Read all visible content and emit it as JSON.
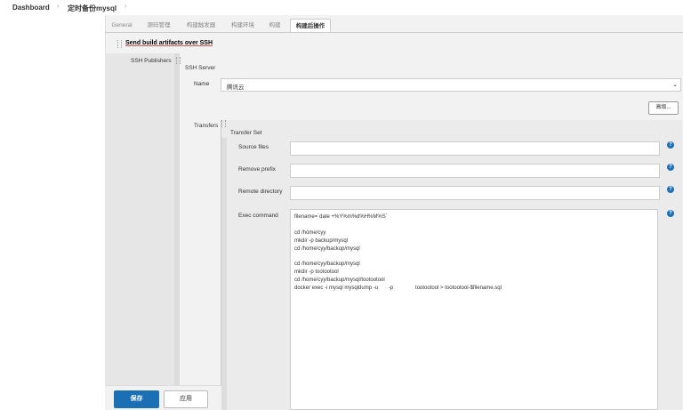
{
  "breadcrumb": {
    "items": [
      "Dashboard",
      "定时备份mysql"
    ],
    "separator": "›"
  },
  "tabs": [
    "General",
    "源码管理",
    "构建触发器",
    "构建环境",
    "构建",
    "构建后操作"
  ],
  "publisher": {
    "title": "Send build artifacts over SSH",
    "ssh_publishers_label": "SSH Publishers",
    "ssh_server_label": "SSH Server",
    "name_label": "Name",
    "name_value": "腾讯云",
    "advanced_button": "高级...",
    "transfers_label": "Transfers",
    "transfer_set_label": "Transfer Set",
    "source_files_label": "Source files",
    "source_files_value": "",
    "remove_prefix_label": "Remove prefix",
    "remove_prefix_value": "",
    "remote_directory_label": "Remote directory",
    "remote_directory_value": "",
    "exec_command_label": "Exec command",
    "exec_command_value": "filename=`date +%Y%m%d%H%M%S`\n\ncd /home/cyy\nmkdir -p backup/mysql\ncd /home/cyy/backup/mysql\n\ncd /home/cyy/backup/mysql\nmkdir -p tootootool\ncd /home/cyy/backup/mysql/tootootool\ndocker exec -i mysql mysqldump -u       -p               tootootool > tootootool-$filename.sql"
  },
  "help_icon_glyph": "?",
  "buttons": {
    "save": "保存",
    "apply": "应用"
  },
  "colors": {
    "primary": "#1a6fb5",
    "title_underline": "#d9534f",
    "panel_bg": "#f2f2f2"
  }
}
